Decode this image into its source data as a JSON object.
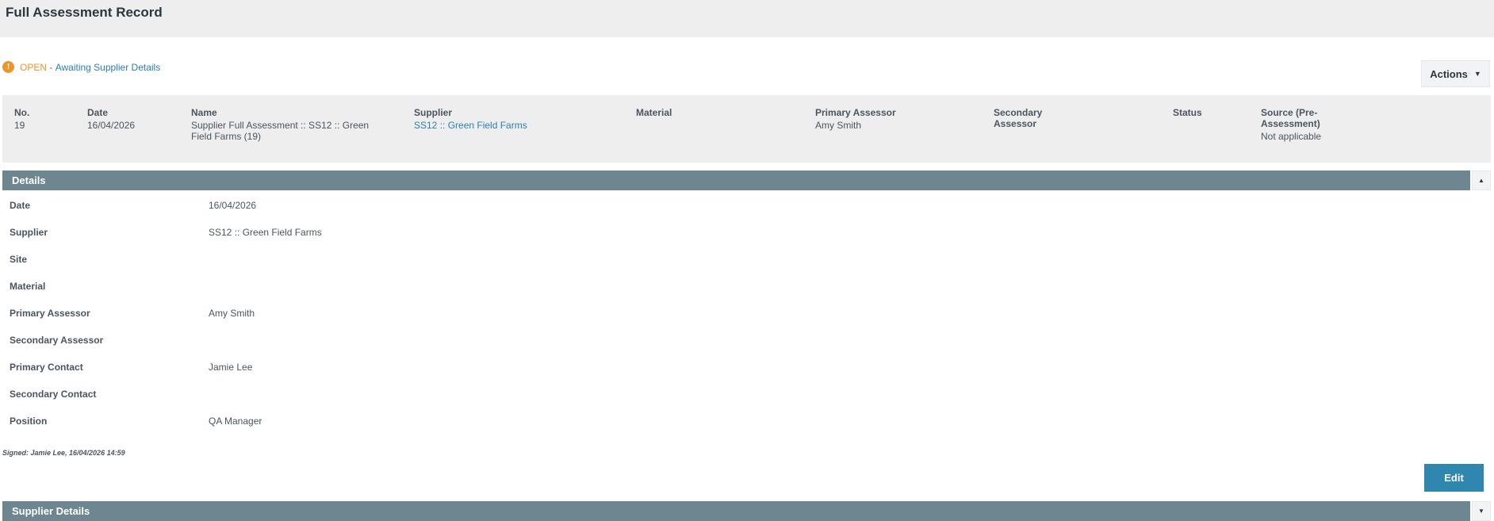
{
  "page": {
    "title": "Full Assessment Record"
  },
  "status": {
    "icon": "exclamation-icon",
    "state": "OPEN",
    "separator": " - ",
    "description": "Awaiting Supplier Details",
    "state_color": "#f0932b",
    "link_color": "#2b7fb5"
  },
  "actions": {
    "label": "Actions",
    "icon": "chevron-down-icon"
  },
  "summary": {
    "no": {
      "label": "No.",
      "value": "19"
    },
    "date": {
      "label": "Date",
      "value": "16/04/2026"
    },
    "name": {
      "label": "Name",
      "value": "Supplier Full Assessment :: SS12 :: Green Field Farms (19)"
    },
    "supplier": {
      "label": "Supplier",
      "value": "SS12 :: Green Field Farms"
    },
    "material": {
      "label": "Material",
      "value": ""
    },
    "primary_assessor": {
      "label": "Primary Assessor",
      "value": "Amy Smith"
    },
    "secondary_assessor": {
      "label": "Secondary Assessor",
      "value": ""
    },
    "status": {
      "label": "Status",
      "value": ""
    },
    "source": {
      "label": "Source (Pre-Assessment)",
      "value": "Not applicable"
    }
  },
  "details_section": {
    "title": "Details",
    "toggle_icon": "caret-up-icon",
    "rows": [
      {
        "label": "Date",
        "value": "16/04/2026"
      },
      {
        "label": "Supplier",
        "value": "SS12 :: Green Field Farms"
      },
      {
        "label": "Site",
        "value": ""
      },
      {
        "label": "Material",
        "value": ""
      },
      {
        "label": "Primary Assessor",
        "value": "Amy Smith"
      },
      {
        "label": "Secondary Assessor",
        "value": ""
      },
      {
        "label": "Primary Contact",
        "value": "Jamie Lee"
      },
      {
        "label": "Secondary Contact",
        "value": ""
      },
      {
        "label": "Position",
        "value": "QA Manager"
      }
    ],
    "signed": "Signed: Jamie Lee, 16/04/2026 14:59",
    "edit_label": "Edit"
  },
  "supplier_section": {
    "title": "Supplier Details",
    "toggle_icon": "caret-down-icon"
  },
  "colors": {
    "section_header": "#6e8690",
    "edit_button": "#2f87b0",
    "panel_bg": "#eeeeee"
  }
}
